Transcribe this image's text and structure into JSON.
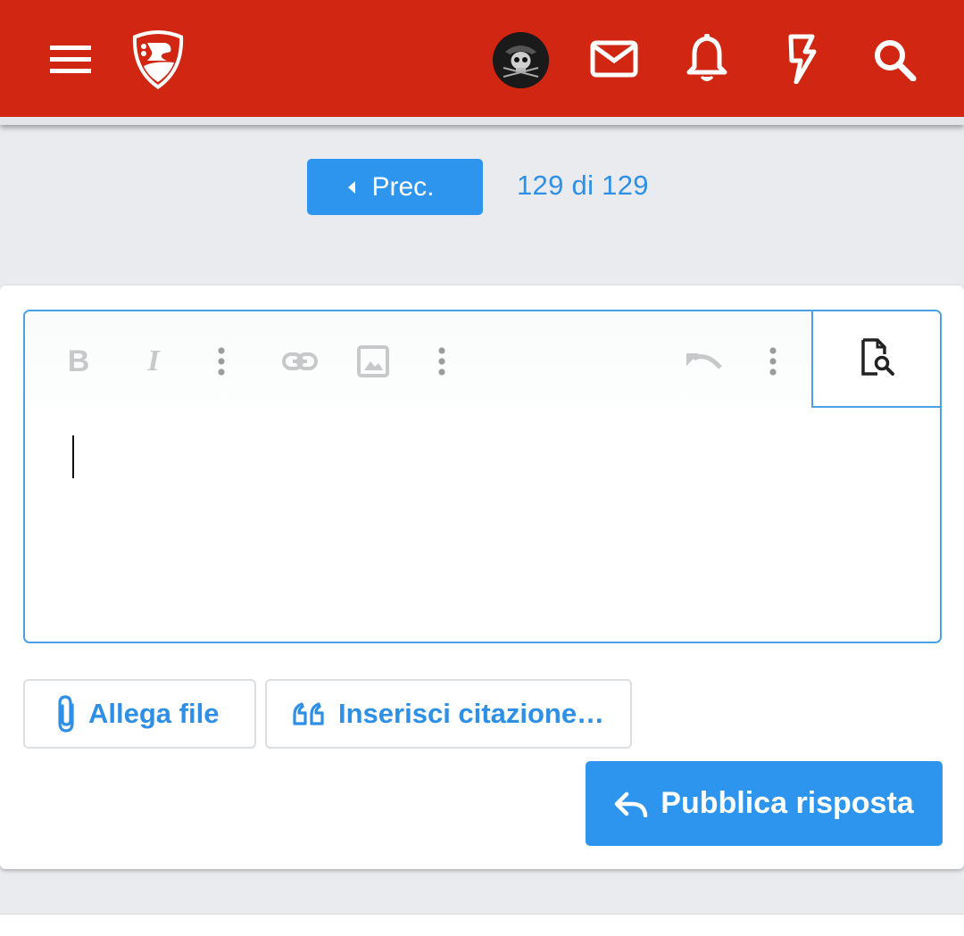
{
  "header": {
    "menu_icon": "hamburger-icon",
    "logo_icon": "forum-logo-shield",
    "avatar_icon": "pirate-skull-avatar",
    "icons": [
      "mail-icon",
      "bell-icon",
      "lightning-icon",
      "search-icon"
    ],
    "background_color": "#d12712"
  },
  "pagination": {
    "prev_label": "Prec.",
    "page_info": "129 di 129"
  },
  "editor": {
    "toolbar_icons": [
      "bold-icon",
      "italic-icon",
      "more-vertical-icon",
      "link-icon",
      "image-icon",
      "more-vertical-icon",
      "undo-icon",
      "more-vertical-icon",
      "preview-icon"
    ],
    "bold_glyph": "B",
    "italic_glyph": "I",
    "content": ""
  },
  "actions": {
    "attach_label": "Allega file",
    "quote_label": "Inserisci citazione…",
    "publish_label": "Pubblica risposta"
  },
  "colors": {
    "accent": "#2e95ef",
    "link_text": "#2e8fe6"
  }
}
